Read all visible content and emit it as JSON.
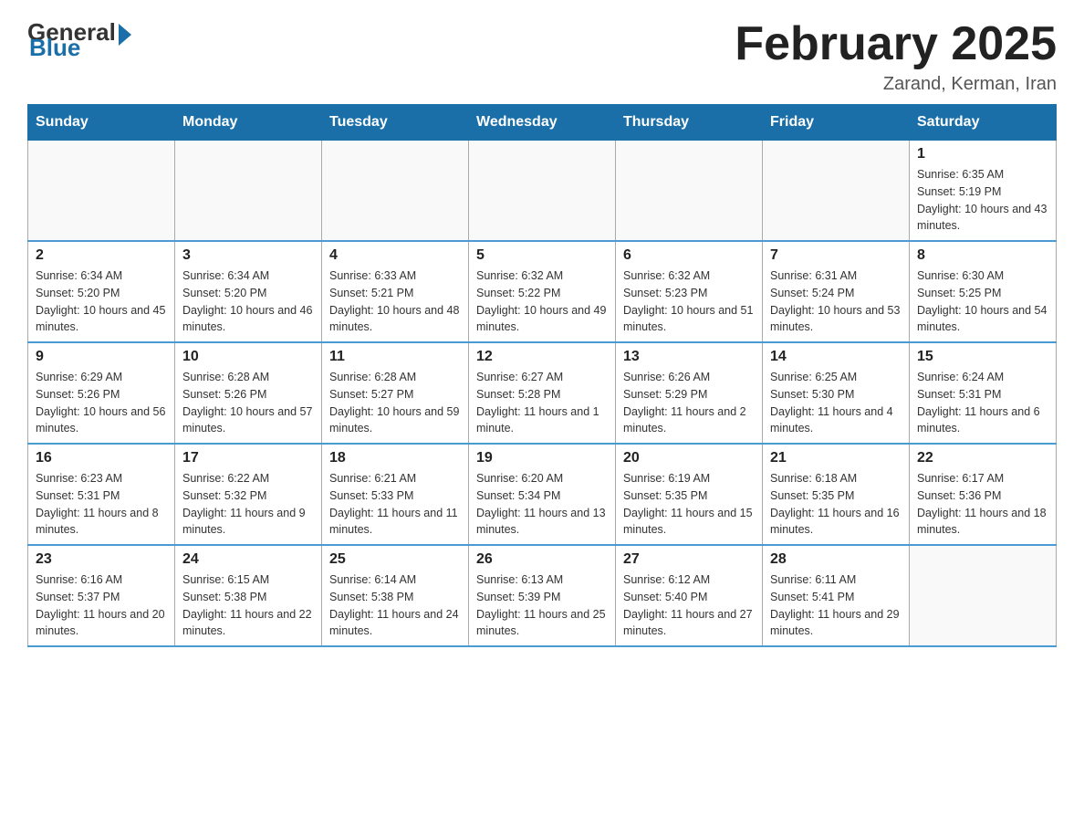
{
  "logo": {
    "general": "General",
    "blue": "Blue"
  },
  "header": {
    "title": "February 2025",
    "location": "Zarand, Kerman, Iran"
  },
  "days_of_week": [
    "Sunday",
    "Monday",
    "Tuesday",
    "Wednesday",
    "Thursday",
    "Friday",
    "Saturday"
  ],
  "weeks": [
    [
      {
        "day": "",
        "sunrise": "",
        "sunset": "",
        "daylight": ""
      },
      {
        "day": "",
        "sunrise": "",
        "sunset": "",
        "daylight": ""
      },
      {
        "day": "",
        "sunrise": "",
        "sunset": "",
        "daylight": ""
      },
      {
        "day": "",
        "sunrise": "",
        "sunset": "",
        "daylight": ""
      },
      {
        "day": "",
        "sunrise": "",
        "sunset": "",
        "daylight": ""
      },
      {
        "day": "",
        "sunrise": "",
        "sunset": "",
        "daylight": ""
      },
      {
        "day": "1",
        "sunrise": "Sunrise: 6:35 AM",
        "sunset": "Sunset: 5:19 PM",
        "daylight": "Daylight: 10 hours and 43 minutes."
      }
    ],
    [
      {
        "day": "2",
        "sunrise": "Sunrise: 6:34 AM",
        "sunset": "Sunset: 5:20 PM",
        "daylight": "Daylight: 10 hours and 45 minutes."
      },
      {
        "day": "3",
        "sunrise": "Sunrise: 6:34 AM",
        "sunset": "Sunset: 5:20 PM",
        "daylight": "Daylight: 10 hours and 46 minutes."
      },
      {
        "day": "4",
        "sunrise": "Sunrise: 6:33 AM",
        "sunset": "Sunset: 5:21 PM",
        "daylight": "Daylight: 10 hours and 48 minutes."
      },
      {
        "day": "5",
        "sunrise": "Sunrise: 6:32 AM",
        "sunset": "Sunset: 5:22 PM",
        "daylight": "Daylight: 10 hours and 49 minutes."
      },
      {
        "day": "6",
        "sunrise": "Sunrise: 6:32 AM",
        "sunset": "Sunset: 5:23 PM",
        "daylight": "Daylight: 10 hours and 51 minutes."
      },
      {
        "day": "7",
        "sunrise": "Sunrise: 6:31 AM",
        "sunset": "Sunset: 5:24 PM",
        "daylight": "Daylight: 10 hours and 53 minutes."
      },
      {
        "day": "8",
        "sunrise": "Sunrise: 6:30 AM",
        "sunset": "Sunset: 5:25 PM",
        "daylight": "Daylight: 10 hours and 54 minutes."
      }
    ],
    [
      {
        "day": "9",
        "sunrise": "Sunrise: 6:29 AM",
        "sunset": "Sunset: 5:26 PM",
        "daylight": "Daylight: 10 hours and 56 minutes."
      },
      {
        "day": "10",
        "sunrise": "Sunrise: 6:28 AM",
        "sunset": "Sunset: 5:26 PM",
        "daylight": "Daylight: 10 hours and 57 minutes."
      },
      {
        "day": "11",
        "sunrise": "Sunrise: 6:28 AM",
        "sunset": "Sunset: 5:27 PM",
        "daylight": "Daylight: 10 hours and 59 minutes."
      },
      {
        "day": "12",
        "sunrise": "Sunrise: 6:27 AM",
        "sunset": "Sunset: 5:28 PM",
        "daylight": "Daylight: 11 hours and 1 minute."
      },
      {
        "day": "13",
        "sunrise": "Sunrise: 6:26 AM",
        "sunset": "Sunset: 5:29 PM",
        "daylight": "Daylight: 11 hours and 2 minutes."
      },
      {
        "day": "14",
        "sunrise": "Sunrise: 6:25 AM",
        "sunset": "Sunset: 5:30 PM",
        "daylight": "Daylight: 11 hours and 4 minutes."
      },
      {
        "day": "15",
        "sunrise": "Sunrise: 6:24 AM",
        "sunset": "Sunset: 5:31 PM",
        "daylight": "Daylight: 11 hours and 6 minutes."
      }
    ],
    [
      {
        "day": "16",
        "sunrise": "Sunrise: 6:23 AM",
        "sunset": "Sunset: 5:31 PM",
        "daylight": "Daylight: 11 hours and 8 minutes."
      },
      {
        "day": "17",
        "sunrise": "Sunrise: 6:22 AM",
        "sunset": "Sunset: 5:32 PM",
        "daylight": "Daylight: 11 hours and 9 minutes."
      },
      {
        "day": "18",
        "sunrise": "Sunrise: 6:21 AM",
        "sunset": "Sunset: 5:33 PM",
        "daylight": "Daylight: 11 hours and 11 minutes."
      },
      {
        "day": "19",
        "sunrise": "Sunrise: 6:20 AM",
        "sunset": "Sunset: 5:34 PM",
        "daylight": "Daylight: 11 hours and 13 minutes."
      },
      {
        "day": "20",
        "sunrise": "Sunrise: 6:19 AM",
        "sunset": "Sunset: 5:35 PM",
        "daylight": "Daylight: 11 hours and 15 minutes."
      },
      {
        "day": "21",
        "sunrise": "Sunrise: 6:18 AM",
        "sunset": "Sunset: 5:35 PM",
        "daylight": "Daylight: 11 hours and 16 minutes."
      },
      {
        "day": "22",
        "sunrise": "Sunrise: 6:17 AM",
        "sunset": "Sunset: 5:36 PM",
        "daylight": "Daylight: 11 hours and 18 minutes."
      }
    ],
    [
      {
        "day": "23",
        "sunrise": "Sunrise: 6:16 AM",
        "sunset": "Sunset: 5:37 PM",
        "daylight": "Daylight: 11 hours and 20 minutes."
      },
      {
        "day": "24",
        "sunrise": "Sunrise: 6:15 AM",
        "sunset": "Sunset: 5:38 PM",
        "daylight": "Daylight: 11 hours and 22 minutes."
      },
      {
        "day": "25",
        "sunrise": "Sunrise: 6:14 AM",
        "sunset": "Sunset: 5:38 PM",
        "daylight": "Daylight: 11 hours and 24 minutes."
      },
      {
        "day": "26",
        "sunrise": "Sunrise: 6:13 AM",
        "sunset": "Sunset: 5:39 PM",
        "daylight": "Daylight: 11 hours and 25 minutes."
      },
      {
        "day": "27",
        "sunrise": "Sunrise: 6:12 AM",
        "sunset": "Sunset: 5:40 PM",
        "daylight": "Daylight: 11 hours and 27 minutes."
      },
      {
        "day": "28",
        "sunrise": "Sunrise: 6:11 AM",
        "sunset": "Sunset: 5:41 PM",
        "daylight": "Daylight: 11 hours and 29 minutes."
      },
      {
        "day": "",
        "sunrise": "",
        "sunset": "",
        "daylight": ""
      }
    ]
  ]
}
